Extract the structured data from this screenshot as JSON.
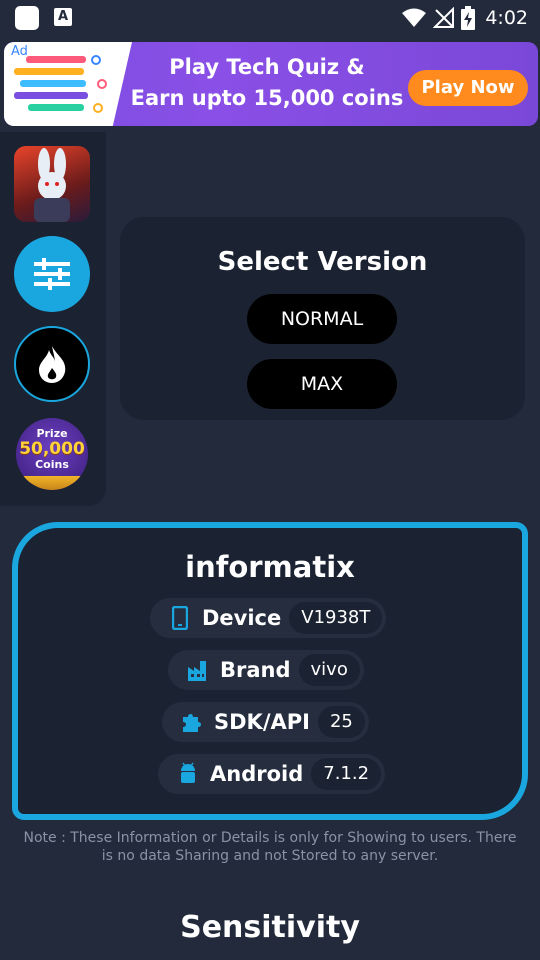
{
  "status_bar": {
    "time": "4:02",
    "notif_letter": "A"
  },
  "ad": {
    "tag": "Ad",
    "line1": "Play Tech Quiz &",
    "line2": "Earn upto 15,000 coins",
    "cta": "Play Now"
  },
  "sidebar": {
    "prize_line1": "Prize",
    "prize_line2": "50,000",
    "prize_line3": "Coins"
  },
  "version": {
    "title": "Select Version",
    "options": [
      "NORMAL",
      "MAX"
    ]
  },
  "informatix": {
    "title": "informatix",
    "rows": [
      {
        "label": "Device",
        "value": "V1938T",
        "icon": "phone-icon"
      },
      {
        "label": "Brand",
        "value": "vivo",
        "icon": "factory-icon"
      },
      {
        "label": "SDK/API",
        "value": "25",
        "icon": "puzzle-icon"
      },
      {
        "label": "Android",
        "value": "7.1.2",
        "icon": "android-icon"
      }
    ]
  },
  "note": "Note : These Information or Details is only for Showing to users. There is no data Sharing and not Stored to any server.",
  "sensitivity_title": "Sensitivity",
  "colors": {
    "background": "#222a3b",
    "card": "#1b2231",
    "accent": "#1aa7e0",
    "ad_button": "#ff8a1e"
  }
}
